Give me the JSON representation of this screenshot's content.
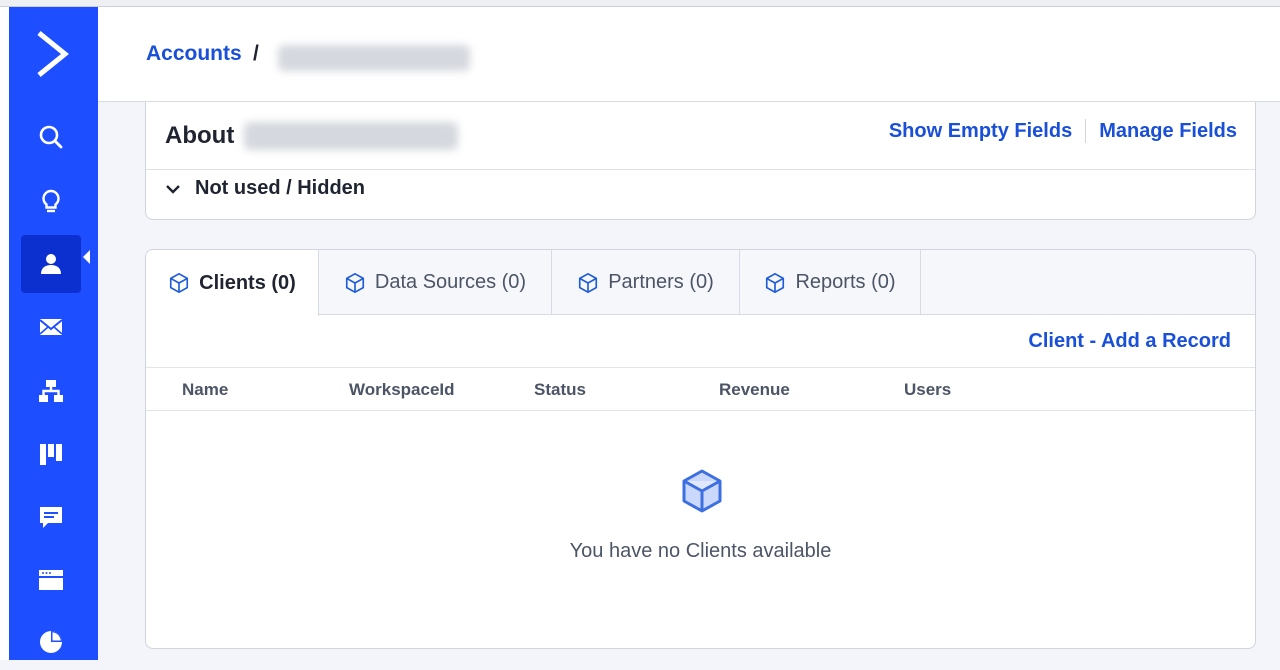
{
  "breadcrumb": {
    "root": "Accounts",
    "separator": "/"
  },
  "about": {
    "title": "About",
    "show_empty_fields": "Show Empty Fields",
    "manage_fields": "Manage Fields",
    "section_label": "Not used / Hidden"
  },
  "tabs": [
    {
      "label": "Clients (0)",
      "icon": "cube-icon",
      "active": true
    },
    {
      "label": "Data Sources (0)",
      "icon": "cube-icon",
      "active": false
    },
    {
      "label": "Partners (0)",
      "icon": "cube-icon",
      "active": false
    },
    {
      "label": "Reports (0)",
      "icon": "cube-icon",
      "active": false
    }
  ],
  "clients": {
    "add_record": "Client - Add a Record",
    "columns": [
      "Name",
      "WorkspaceId",
      "Status",
      "Revenue",
      "Users"
    ],
    "empty_message": "You have no Clients available"
  },
  "sidebar": {
    "items": [
      {
        "icon": "search-icon"
      },
      {
        "icon": "lightbulb-icon"
      },
      {
        "icon": "contacts-icon",
        "active": true
      },
      {
        "icon": "email-icon"
      },
      {
        "icon": "automation-icon"
      },
      {
        "icon": "pipeline-icon"
      },
      {
        "icon": "conversations-icon"
      },
      {
        "icon": "website-icon"
      },
      {
        "icon": "reports-icon"
      }
    ]
  },
  "colors": {
    "sidebar": "#1d4eff",
    "sidebar_active": "#0c2fcf",
    "link": "#1a4fd8",
    "text": "#1f2430",
    "muted_text": "#4c5566",
    "background": "#f3f5fa"
  }
}
